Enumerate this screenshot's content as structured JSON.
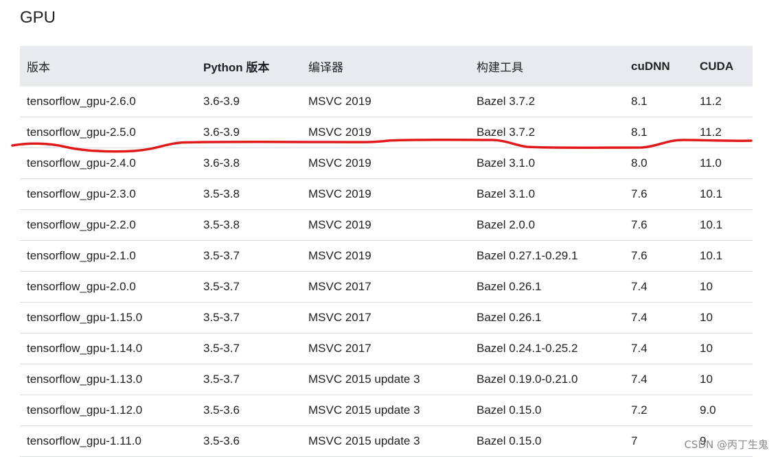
{
  "section": {
    "title": "GPU"
  },
  "table": {
    "headers": [
      "版本",
      "Python 版本",
      "编译器",
      "构建工具",
      "cuDNN",
      "CUDA"
    ],
    "rows": [
      [
        "tensorflow_gpu-2.6.0",
        "3.6-3.9",
        "MSVC 2019",
        "Bazel 3.7.2",
        "8.1",
        "11.2"
      ],
      [
        "tensorflow_gpu-2.5.0",
        "3.6-3.9",
        "MSVC 2019",
        "Bazel 3.7.2",
        "8.1",
        "11.2"
      ],
      [
        "tensorflow_gpu-2.4.0",
        "3.6-3.8",
        "MSVC 2019",
        "Bazel 3.1.0",
        "8.0",
        "11.0"
      ],
      [
        "tensorflow_gpu-2.3.0",
        "3.5-3.8",
        "MSVC 2019",
        "Bazel 3.1.0",
        "7.6",
        "10.1"
      ],
      [
        "tensorflow_gpu-2.2.0",
        "3.5-3.8",
        "MSVC 2019",
        "Bazel 2.0.0",
        "7.6",
        "10.1"
      ],
      [
        "tensorflow_gpu-2.1.0",
        "3.5-3.7",
        "MSVC 2019",
        "Bazel 0.27.1-0.29.1",
        "7.6",
        "10.1"
      ],
      [
        "tensorflow_gpu-2.0.0",
        "3.5-3.7",
        "MSVC 2017",
        "Bazel 0.26.1",
        "7.4",
        "10"
      ],
      [
        "tensorflow_gpu-1.15.0",
        "3.5-3.7",
        "MSVC 2017",
        "Bazel 0.26.1",
        "7.4",
        "10"
      ],
      [
        "tensorflow_gpu-1.14.0",
        "3.5-3.7",
        "MSVC 2017",
        "Bazel 0.24.1-0.25.2",
        "7.4",
        "10"
      ],
      [
        "tensorflow_gpu-1.13.0",
        "3.5-3.7",
        "MSVC 2015 update 3",
        "Bazel 0.19.0-0.21.0",
        "7.4",
        "10"
      ],
      [
        "tensorflow_gpu-1.12.0",
        "3.5-3.6",
        "MSVC 2015 update 3",
        "Bazel 0.15.0",
        "7.2",
        "9.0"
      ],
      [
        "tensorflow_gpu-1.11.0",
        "3.5-3.6",
        "MSVC 2015 update 3",
        "Bazel 0.15.0",
        "7",
        "9"
      ]
    ]
  },
  "annotation": {
    "color": "#e0191b",
    "description_highlighted_row": "tensorflow_gpu-2.5.0"
  },
  "watermark": {
    "text": "CSDN @丙丁生鬼"
  }
}
